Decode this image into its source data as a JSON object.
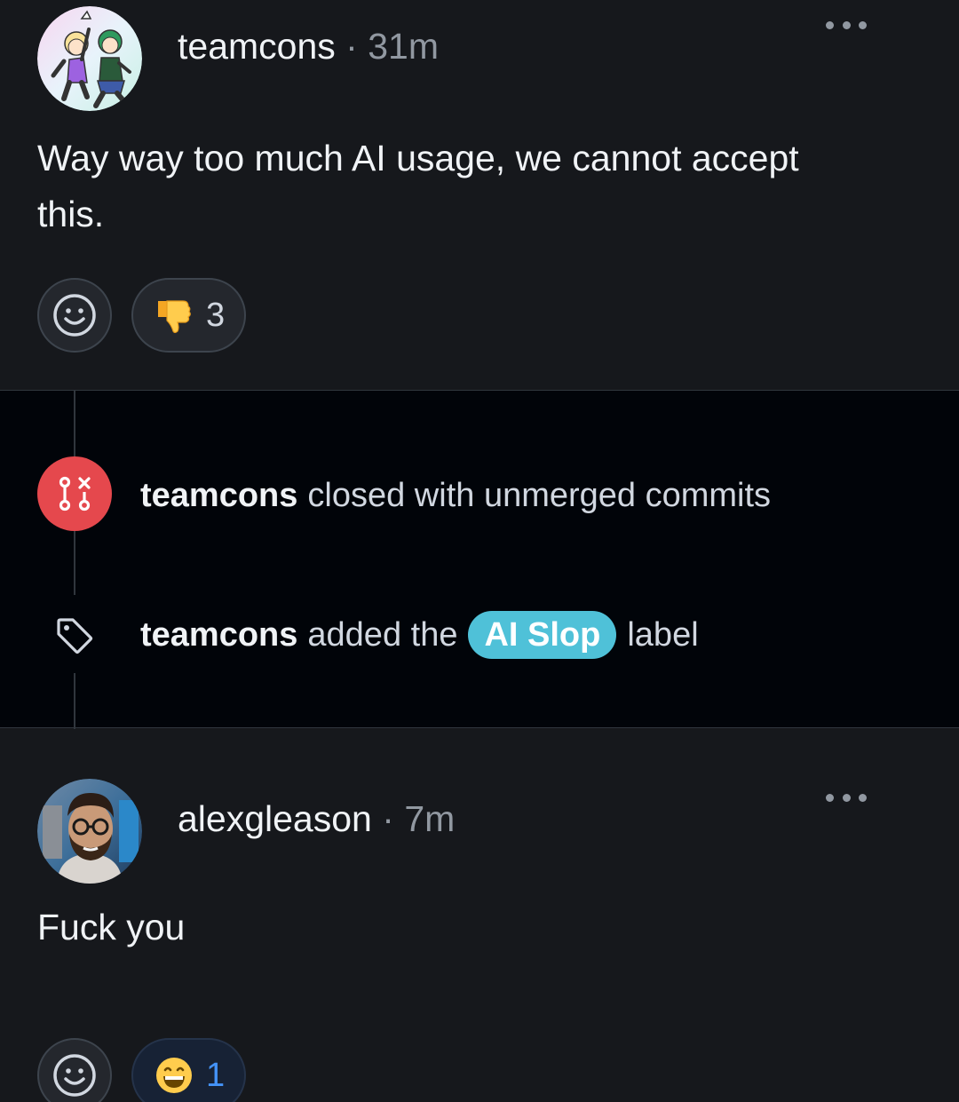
{
  "comments": [
    {
      "author": "teamcons",
      "separator": "·",
      "time": "31m",
      "body": "Way way too much AI usage, we cannot accept this.",
      "reaction": {
        "emoji": "thumbs-down",
        "count": "3"
      }
    },
    {
      "author": "alexgleason",
      "separator": "·",
      "time": "7m",
      "body": "Fuck you",
      "reaction": {
        "emoji": "grinning-face",
        "count": "1"
      }
    }
  ],
  "events": {
    "closed": {
      "actor": "teamcons",
      "text": "closed with unmerged commits"
    },
    "label": {
      "actor": "teamcons",
      "prefix": "added the",
      "label": "AI Slop",
      "suffix": "label",
      "label_color": "#4fc1d8"
    }
  },
  "colors": {
    "closed_badge": "#e5484d",
    "background": "#16181c",
    "timeline_background": "#010409",
    "active_count": "#4493f8"
  },
  "icons": [
    "kebab-menu-icon",
    "smiley-icon",
    "git-pull-request-closed-icon",
    "tag-icon"
  ]
}
